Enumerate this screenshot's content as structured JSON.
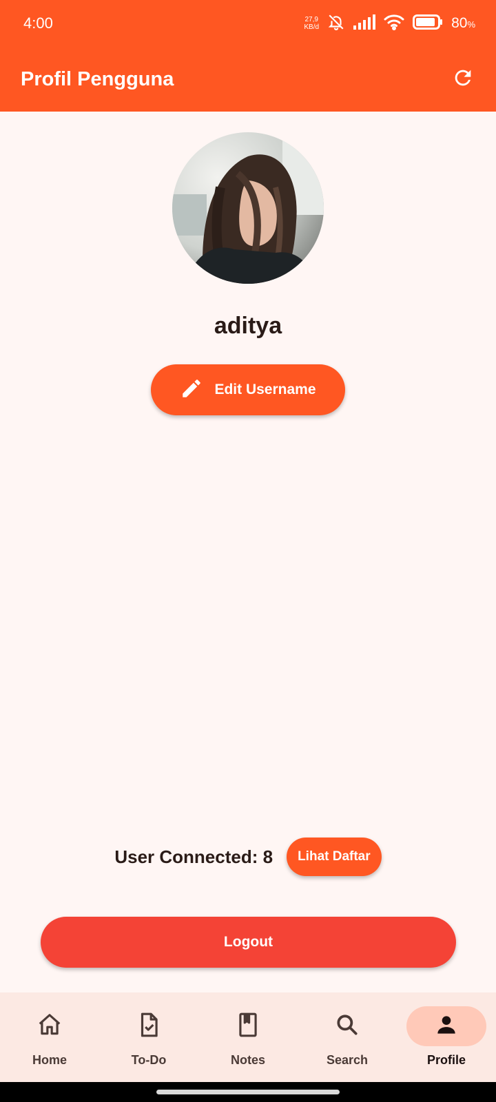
{
  "status_bar": {
    "time": "4:00",
    "net_speed_value": "27,9",
    "net_speed_unit": "KB/d",
    "battery": "80",
    "battery_unit": "%"
  },
  "app_bar": {
    "title": "Profil Pengguna",
    "refresh_icon": "refresh-icon"
  },
  "profile": {
    "username": "aditya",
    "edit_button_label": "Edit Username",
    "edit_icon": "pencil-icon"
  },
  "connection": {
    "text": "User Connected: 8",
    "button_label": "Lihat Daftar"
  },
  "logout_label": "Logout",
  "bottom_nav": {
    "items": [
      {
        "label": "Home",
        "icon": "home-icon"
      },
      {
        "label": "To-Do",
        "icon": "todo-icon"
      },
      {
        "label": "Notes",
        "icon": "book-icon"
      },
      {
        "label": "Search",
        "icon": "search-icon"
      },
      {
        "label": "Profile",
        "icon": "person-icon"
      }
    ],
    "active": "Profile"
  },
  "colors": {
    "primary": "#FF5722",
    "logout": "#F44336",
    "background": "#FFF6F4",
    "nav_background": "#FCE9E3",
    "nav_active_pill": "#FFC9B8"
  }
}
